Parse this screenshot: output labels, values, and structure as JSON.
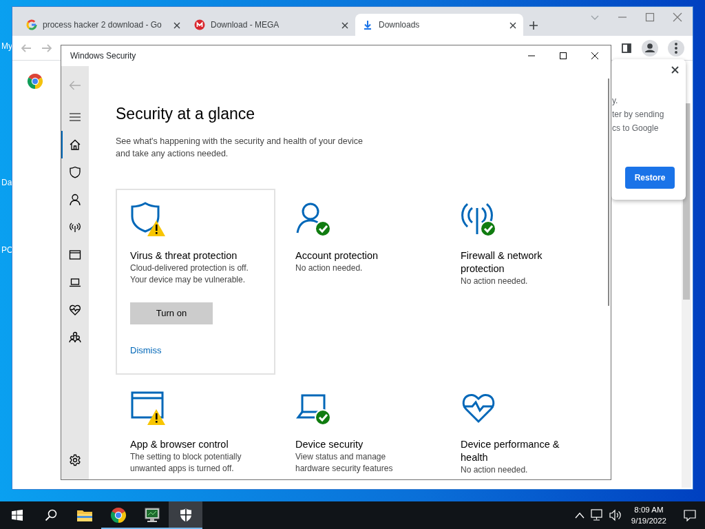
{
  "desktop": {
    "icon_labels": [
      "My",
      "Da",
      "PC"
    ]
  },
  "browser": {
    "tabs": [
      {
        "title": "process hacker 2 download - Go",
        "selected": false
      },
      {
        "title": "Download - MEGA",
        "selected": false
      },
      {
        "title": "Downloads",
        "selected": true
      }
    ],
    "popup": {
      "lines": [
        "y.",
        "ter by sending",
        "cs to Google"
      ],
      "button": "Restore"
    }
  },
  "security": {
    "title": "Windows Security",
    "nav": [
      {
        "selected": true
      },
      {
        "selected": false
      },
      {
        "selected": false
      },
      {
        "selected": false
      },
      {
        "selected": false
      },
      {
        "selected": false
      },
      {
        "selected": false
      },
      {
        "selected": false
      }
    ],
    "heading": "Security at a glance",
    "description": "See what's happening with the security and health of your device and take any actions needed.",
    "cards": [
      {
        "title": "Virus & threat protection",
        "description": "Cloud-delivered protection is off. Your device may be vulnerable.",
        "warning": true,
        "ok": false,
        "button": "Turn on",
        "link": "Dismiss",
        "highlighted": true
      },
      {
        "title": "Account protection",
        "description": "No action needed.",
        "warning": false,
        "ok": true,
        "highlighted": false
      },
      {
        "title": "Firewall & network protection",
        "description": "No action needed.",
        "warning": false,
        "ok": true,
        "highlighted": false
      },
      {
        "title": "App & browser control",
        "description": "The setting to block potentially unwanted apps is turned off.",
        "warning": true,
        "ok": false,
        "highlighted": false
      },
      {
        "title": "Device security",
        "description": "View status and manage hardware security features",
        "warning": false,
        "ok": true,
        "highlighted": false
      },
      {
        "title": "Device performance & health",
        "description": "No action needed.",
        "warning": false,
        "ok": false,
        "highlighted": false
      }
    ]
  },
  "taskbar": {
    "apps": [
      {
        "running": false,
        "active": false
      },
      {
        "running": false,
        "active": false
      },
      {
        "running": false,
        "active": false
      },
      {
        "running": true,
        "active": false
      },
      {
        "running": true,
        "active": false
      },
      {
        "running": true,
        "active": true
      }
    ],
    "time": "8:09 AM",
    "date": "9/19/2022"
  }
}
